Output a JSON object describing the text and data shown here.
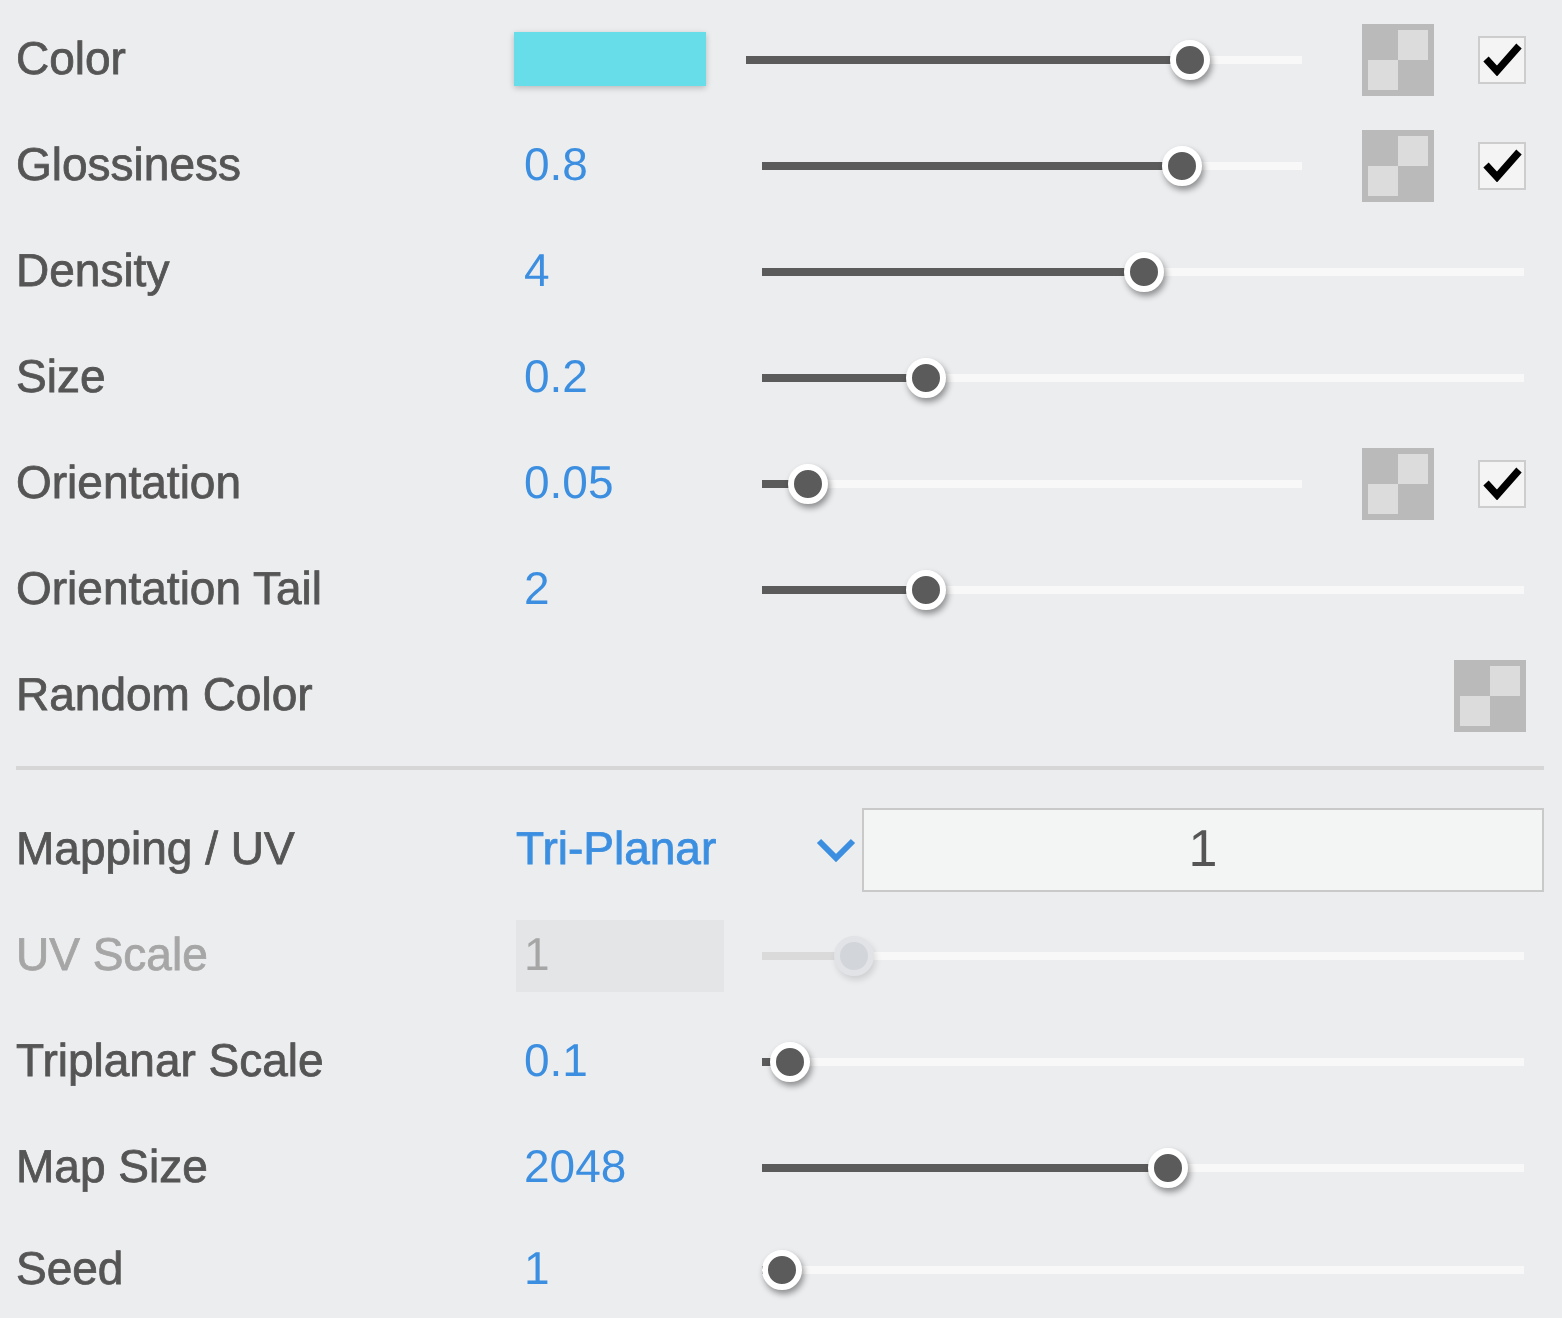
{
  "sections": [
    {
      "rows": [
        {
          "kind": "color",
          "label": "Color",
          "color": "#66dde9",
          "level": 0.82,
          "disabled": false,
          "texture_slot": true,
          "checked": true
        },
        {
          "kind": "slider",
          "label": "Glossiness",
          "value": "0.8",
          "level": 0.8,
          "disabled": false,
          "texture_slot": true,
          "checked": true
        },
        {
          "kind": "slider",
          "label": "Density",
          "value": "4",
          "level": 0.5,
          "disabled": false
        },
        {
          "kind": "slider",
          "label": "Size",
          "value": "0.2",
          "level": 0.2,
          "disabled": false
        },
        {
          "kind": "slider",
          "label": "Orientation",
          "value": "0.05",
          "level": 0.05,
          "disabled": false,
          "texture_slot": true,
          "checked": true
        },
        {
          "kind": "slider",
          "label": "Orientation Tail",
          "value": "2",
          "level": 0.2,
          "disabled": false
        },
        {
          "kind": "texture",
          "label": "Random Color",
          "disabled": false,
          "texture_slot": true
        }
      ]
    },
    {
      "rows": [
        {
          "kind": "dropdown",
          "label": "Mapping / UV",
          "value": "Tri-Planar",
          "field_value": "1",
          "disabled": false
        },
        {
          "kind": "slider",
          "label": "UV Scale",
          "value": "1",
          "level": 0.1,
          "disabled": true
        },
        {
          "kind": "slider",
          "label": "Triplanar Scale",
          "value": "0.1",
          "level": 0.01,
          "disabled": false
        },
        {
          "kind": "slider",
          "label": "Map Size",
          "value": "2048",
          "level": 0.535,
          "disabled": false
        },
        {
          "kind": "slider",
          "label": "Seed",
          "value": "1",
          "level": 0,
          "disabled": false
        }
      ]
    }
  ]
}
